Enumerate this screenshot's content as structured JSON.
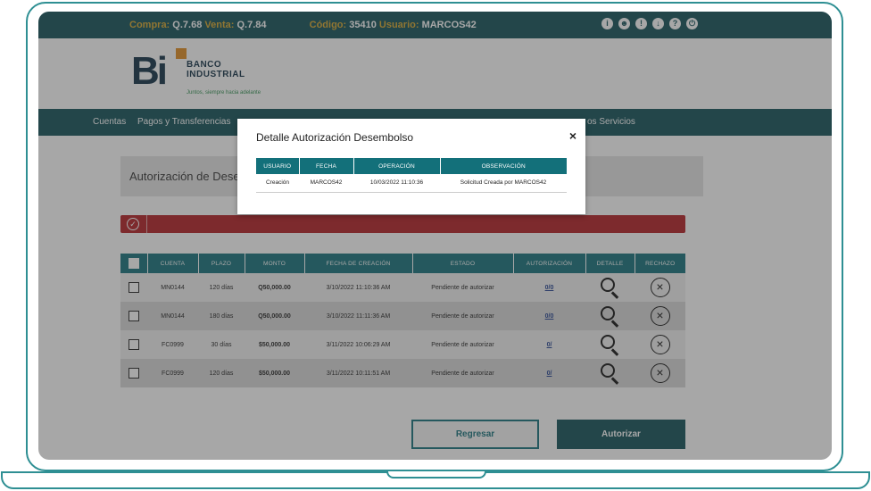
{
  "topbar": {
    "compra_label": "Compra:",
    "compra_value": "Q.7.68",
    "venta_label": "Venta:",
    "venta_value": "Q.7.84",
    "codigo_label": "Código:",
    "codigo_value": "35410",
    "usuario_label": "Usuario:",
    "usuario_value": "MARCOS42",
    "icons": [
      "info-icon",
      "user-icon",
      "lightbulb-icon",
      "download-icon",
      "help-icon",
      "power-icon"
    ]
  },
  "logo": {
    "mark": "Bi",
    "name_line1": "BANCO",
    "name_line2": "INDUSTRIAL",
    "slogan": "Juntos, siempre hacia adelante"
  },
  "nav": {
    "items": [
      "Cuentas",
      "Pagos y Transferencias",
      "os Servicios"
    ]
  },
  "page": {
    "title": "Autorización de Desem"
  },
  "table": {
    "headers": [
      "CUENTA",
      "PLAZO",
      "MONTO",
      "FECHA DE CREACIÓN",
      "ESTADO",
      "AUTORIZACIÓN",
      "DETALLE",
      "RECHAZO"
    ],
    "rows": [
      {
        "cuenta": "MN0144",
        "plazo": "120 días",
        "monto": "Q50,000.00",
        "fecha": "3/10/2022 11:10:36 AM",
        "estado": "Pendiente de autorizar",
        "autorizacion": "0/0"
      },
      {
        "cuenta": "MN0144",
        "plazo": "180 días",
        "monto": "Q50,000.00",
        "fecha": "3/10/2022 11:11:36 AM",
        "estado": "Pendiente de autorizar",
        "autorizacion": "0/0"
      },
      {
        "cuenta": "FC0999",
        "plazo": "30 días",
        "monto": "$50,000.00",
        "fecha": "3/11/2022 10:06:29 AM",
        "estado": "Pendiente de autorizar",
        "autorizacion": "0/"
      },
      {
        "cuenta": "FC0999",
        "plazo": "120 días",
        "monto": "$50,000.00",
        "fecha": "3/11/2022 10:11:51 AM",
        "estado": "Pendiente de autorizar",
        "autorizacion": "0/"
      }
    ]
  },
  "buttons": {
    "regresar": "Regresar",
    "autorizar": "Autorizar"
  },
  "modal": {
    "title": "Detalle Autorización Desembolso",
    "close": "×",
    "headers": [
      "USUARIO",
      "FECHA",
      "OPERACIÓN",
      "OBSERVACIÓN"
    ],
    "row": {
      "usuario": "Creación",
      "fecha": "MARCOS42",
      "operacion": "10/03/2022 11:10:36",
      "observacion": "Solicitud Creada por MARCOS42"
    }
  },
  "colors": {
    "primary": "#0f4f57",
    "table_header": "#13707a",
    "alert": "#b21c22",
    "accent_gold": "#d8a62a",
    "frame": "#2e8f93"
  }
}
